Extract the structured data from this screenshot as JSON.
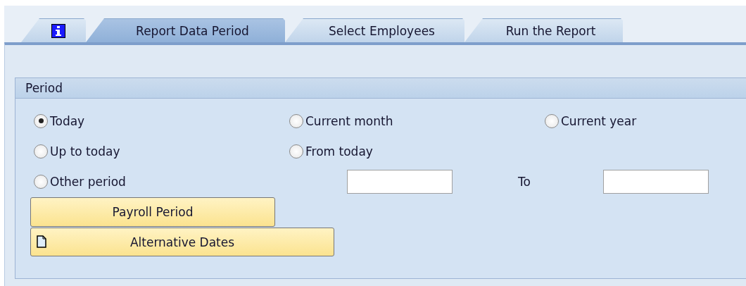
{
  "tabs": [
    {
      "kind": "info",
      "selected": false
    },
    {
      "kind": "text",
      "label": "Report Data Period",
      "selected": true
    },
    {
      "kind": "text",
      "label": "Select Employees",
      "selected": false
    },
    {
      "kind": "text",
      "label": "Run the Report",
      "selected": false
    }
  ],
  "group": {
    "title": "Period",
    "radio_rows": [
      [
        {
          "label": "Today",
          "selected": true
        },
        {
          "label": "Current month",
          "selected": false
        },
        {
          "label": "Current year",
          "selected": false
        }
      ],
      [
        {
          "label": "Up to today",
          "selected": false
        },
        {
          "label": "From today",
          "selected": false
        }
      ],
      [
        {
          "label": "Other period",
          "selected": false
        }
      ]
    ],
    "to_label": "To",
    "buttons": [
      {
        "label": "Payroll Period",
        "kind": "plain"
      },
      {
        "label": "Alternative Dates",
        "kind": "document"
      }
    ]
  }
}
